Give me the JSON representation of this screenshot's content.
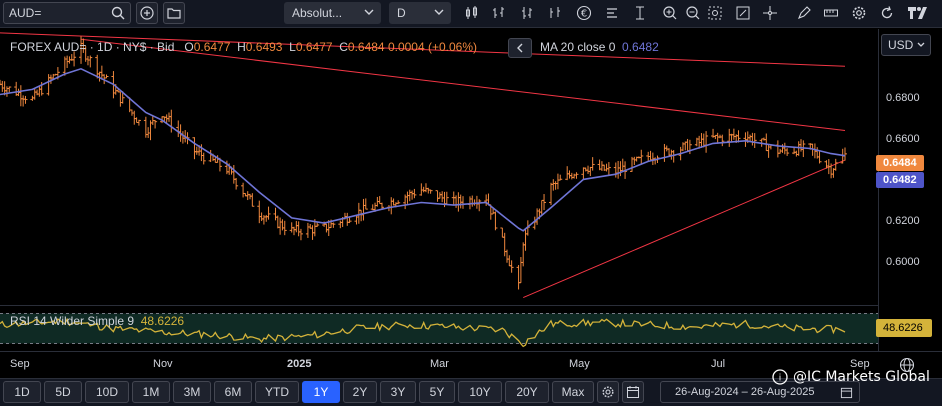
{
  "toolbar": {
    "symbol": "AUD=",
    "scale_mode": "Absolut...",
    "interval": "D"
  },
  "legend": {
    "title": "FOREX AUD= · 1D · NY$ · Bid",
    "o_label": "O",
    "o": "0.6477",
    "h_label": "H",
    "h": "0.6493",
    "l_label": "L",
    "l": "0.6477",
    "c_label": "C",
    "c": "0.6484",
    "chg": "0.0004 (+0.06%)",
    "ma_label": "MA 20 close 0",
    "ma_value": "0.6482"
  },
  "scale": {
    "currency": "USD",
    "ticks": [
      "0.6800",
      "0.6600",
      "0.6400",
      "0.6200",
      "0.6000"
    ],
    "last_price": "0.6484",
    "ma_price": "0.6482"
  },
  "rsi": {
    "label": "RSI 14 Wilder Simple 9",
    "value": "48.6226",
    "tag": "48.6226"
  },
  "xaxis": {
    "labels": [
      "Sep",
      "Nov",
      "2025",
      "Mar",
      "May",
      "Jul",
      "Sep"
    ]
  },
  "ranges": [
    "1D",
    "5D",
    "10D",
    "1M",
    "3M",
    "6M",
    "YTD",
    "1Y",
    "2Y",
    "3Y",
    "5Y",
    "10Y",
    "20Y",
    "Max"
  ],
  "active_range": "1Y",
  "date_range": "26-Aug-2024  –  26-Aug-2025",
  "watermark": "@IC Markets Global",
  "colors": {
    "candle": "#f0883e",
    "ma": "#6f75d6",
    "trendline": "#f23645",
    "rsi": "#d4b33a",
    "accent": "#2962ff"
  },
  "chart_data": {
    "type": "line",
    "title": "FOREX AUD= · 1D · NY$ · Bid",
    "ylim": [
      0.5905,
      0.6975
    ],
    "x_range": [
      "2024-08-26",
      "2025-08-26"
    ],
    "series": [
      {
        "name": "AUD=",
        "x": [
          "2024-08-26",
          "2024-09-09",
          "2024-09-23",
          "2024-09-30",
          "2024-10-14",
          "2024-10-28",
          "2024-11-04",
          "2024-11-18",
          "2024-12-02",
          "2024-12-16",
          "2024-12-30",
          "2025-01-13",
          "2025-01-27",
          "2025-02-10",
          "2025-02-24",
          "2025-03-10",
          "2025-03-24",
          "2025-04-07",
          "2025-04-09",
          "2025-04-21",
          "2025-05-05",
          "2025-05-19",
          "2025-06-02",
          "2025-06-16",
          "2025-06-30",
          "2025-07-14",
          "2025-07-28",
          "2025-08-11",
          "2025-08-20",
          "2025-08-26"
        ],
        "values": [
          0.676,
          0.67,
          0.684,
          0.69,
          0.674,
          0.658,
          0.665,
          0.65,
          0.643,
          0.626,
          0.619,
          0.62,
          0.626,
          0.63,
          0.635,
          0.63,
          0.632,
          0.597,
          0.615,
          0.636,
          0.644,
          0.642,
          0.648,
          0.651,
          0.655,
          0.656,
          0.65,
          0.651,
          0.643,
          0.6484
        ]
      },
      {
        "name": "MA 20 close 0",
        "x": [
          "2024-08-26",
          "2024-09-09",
          "2024-09-23",
          "2024-09-30",
          "2024-10-14",
          "2024-10-28",
          "2024-11-04",
          "2024-11-18",
          "2024-12-02",
          "2024-12-16",
          "2024-12-30",
          "2025-01-13",
          "2025-01-27",
          "2025-02-10",
          "2025-02-24",
          "2025-03-10",
          "2025-03-24",
          "2025-04-07",
          "2025-04-09",
          "2025-04-21",
          "2025-05-05",
          "2025-05-19",
          "2025-06-02",
          "2025-06-16",
          "2025-06-30",
          "2025-07-14",
          "2025-07-28",
          "2025-08-11",
          "2025-08-20",
          "2025-08-26"
        ],
        "values": [
          0.672,
          0.674,
          0.68,
          0.682,
          0.676,
          0.665,
          0.662,
          0.653,
          0.645,
          0.634,
          0.624,
          0.622,
          0.625,
          0.628,
          0.63,
          0.629,
          0.63,
          0.62,
          0.619,
          0.628,
          0.639,
          0.641,
          0.646,
          0.649,
          0.653,
          0.654,
          0.652,
          0.651,
          0.649,
          0.6482
        ]
      }
    ],
    "trendlines": [
      {
        "x": [
          "2024-08-26",
          "2025-08-26"
        ],
        "values": [
          0.696,
          0.683
        ]
      },
      {
        "x": [
          "2024-09-30",
          "2025-08-26"
        ],
        "values": [
          0.6935,
          0.658
        ]
      },
      {
        "x": [
          "2025-04-09",
          "2025-08-26"
        ],
        "values": [
          0.593,
          0.6465
        ]
      }
    ],
    "rsi": {
      "name": "RSI 14 Wilder Simple 9",
      "x": [
        "2024-08-26",
        "2024-09-23",
        "2024-10-14",
        "2024-11-04",
        "2024-11-25",
        "2024-12-16",
        "2025-01-06",
        "2025-01-27",
        "2025-02-17",
        "2025-03-10",
        "2025-03-31",
        "2025-04-09",
        "2025-04-21",
        "2025-05-12",
        "2025-06-02",
        "2025-06-23",
        "2025-07-14",
        "2025-08-04",
        "2025-08-26"
      ],
      "values": [
        55,
        60,
        50,
        45,
        42,
        36,
        40,
        50,
        55,
        52,
        48,
        30,
        56,
        58,
        55,
        52,
        56,
        50,
        48.6226
      ],
      "ylim": [
        20,
        80
      ]
    }
  }
}
